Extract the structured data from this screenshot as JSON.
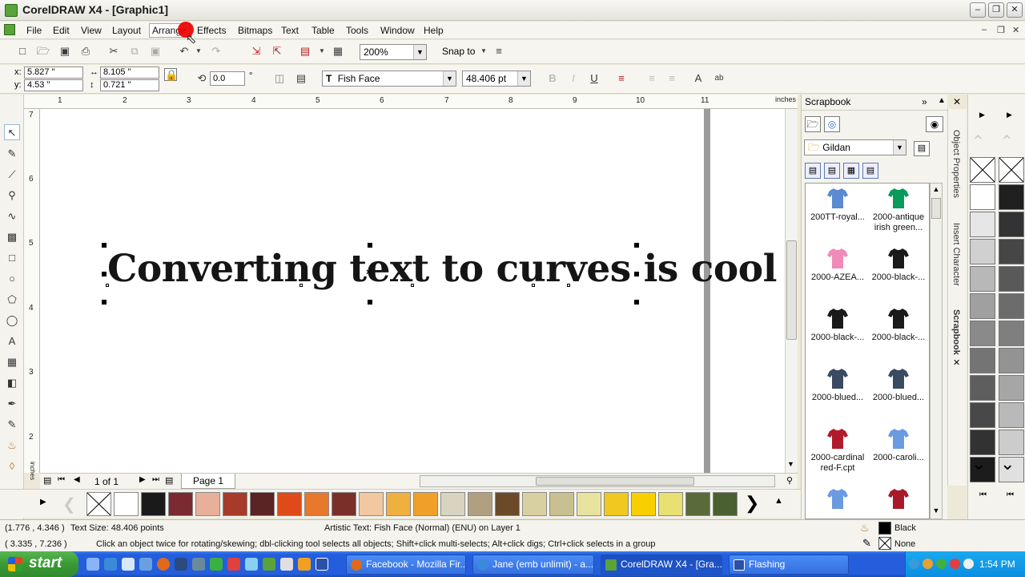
{
  "window": {
    "title": "CorelDRAW X4 - [Graphic1]"
  },
  "menu": [
    "File",
    "Edit",
    "View",
    "Layout",
    "Arrange",
    "Effects",
    "Bitmaps",
    "Text",
    "Table",
    "Tools",
    "Window",
    "Help"
  ],
  "toolbar": {
    "zoom": "200%",
    "snap_label": "Snap to"
  },
  "property_bar": {
    "x": "5.827 \"",
    "y": "4.53 \"",
    "width": "8.105 \"",
    "height": "0.721 \"",
    "x_label": "x:",
    "y_label": "y:",
    "rotation": "0.0",
    "rotation_unit": "°",
    "font": "Fish Face",
    "font_size": "48.406 pt",
    "underline": "U",
    "abl": "ab"
  },
  "ruler": {
    "unit": "inches",
    "h_ticks": [
      "1",
      "2",
      "3",
      "4",
      "5",
      "6",
      "7",
      "8",
      "9",
      "10",
      "11"
    ],
    "v_ticks": [
      "7",
      "6",
      "5",
      "4",
      "3",
      "2"
    ],
    "v_unit": "inches"
  },
  "canvas": {
    "artistic_text": "Converting text to curves is cool"
  },
  "page_nav": {
    "page_count": "1 of 1",
    "page_tab": "Page 1"
  },
  "colors": {
    "palette": [
      "#ffffff",
      "#1a1a1a",
      "#7a2a30",
      "#e8b098",
      "#a83a2a",
      "#5a2424",
      "#e04a1a",
      "#e8782c",
      "#7a3028",
      "#f2c8a0",
      "#f0b040",
      "#f0a028",
      "#d8d4c0",
      "#b0a080",
      "#6a4a28",
      "#d8d0a0",
      "#c8c090",
      "#e8e4a0",
      "#f0c820",
      "#f8d000",
      "#e8e070",
      "#5a6a38",
      "#4a6030"
    ],
    "gray_left": [
      "#ffffff",
      "#e6e6e6",
      "#d0d0d0",
      "#b8b8b8",
      "#a0a0a0",
      "#8a8a8a",
      "#747474",
      "#5e5e5e",
      "#484848",
      "#323232",
      "#1c1c1c"
    ],
    "gray_right": [
      "#202020",
      "#333333",
      "#464646",
      "#595959",
      "#6c6c6c",
      "#7f7f7f",
      "#939393",
      "#a6a6a6",
      "#b9b9b9",
      "#cccccc",
      "#e0e0e0"
    ]
  },
  "scrapbook": {
    "title": "Scrapbook",
    "folder": "Gildan",
    "items": [
      {
        "label": "200TT-royal...",
        "color": "#5a8ad0"
      },
      {
        "label": "2000-antique irish green...",
        "color": "#0a9a5a"
      },
      {
        "label": "2000-AZEA...",
        "color": "#f08ab8"
      },
      {
        "label": "2000-black-...",
        "color": "#1a1a1a"
      },
      {
        "label": "2000-black-...",
        "color": "#1a1a1a"
      },
      {
        "label": "2000-black-...",
        "color": "#1a1a1a"
      },
      {
        "label": "2000-blued...",
        "color": "#3a4a60"
      },
      {
        "label": "2000-blued...",
        "color": "#3a4a60"
      },
      {
        "label": "2000-cardinal red-F.cpt",
        "color": "#b01a2a"
      },
      {
        "label": "2000-caroli...",
        "color": "#6a9ae0"
      },
      {
        "label": "",
        "color": "#6a9ae0"
      },
      {
        "label": "",
        "color": "#a81a2a"
      }
    ],
    "side_tabs": [
      "Object Properties",
      "Insert Character",
      "Scrapbook"
    ]
  },
  "status": {
    "coords": "(1.776 , 4.346 )",
    "text_size": "Text Size: 48.406 points",
    "object_info": "Artistic Text: Fish Face (Normal) (ENU) on Layer 1",
    "fill_label": "Black",
    "cursor_coords": "( 3.335 , 7.236 )",
    "hint": "Click an object twice for rotating/skewing; dbl-clicking tool selects all objects; Shift+click multi-selects; Alt+click digs; Ctrl+click selects in a group",
    "outline_label": "None"
  },
  "taskbar": {
    "start": "start",
    "tasks": [
      {
        "label": "Facebook - Mozilla Fir...",
        "color": "#e06a1a"
      },
      {
        "label": "Jane (emb unlimit) - a...",
        "color": "#3a8ad8"
      },
      {
        "label": "CorelDRAW X4 - [Gra...",
        "color": "#5aa23a"
      },
      {
        "label": "Flashing",
        "color": "#2a50a8"
      }
    ],
    "clock": "1:54 PM"
  }
}
